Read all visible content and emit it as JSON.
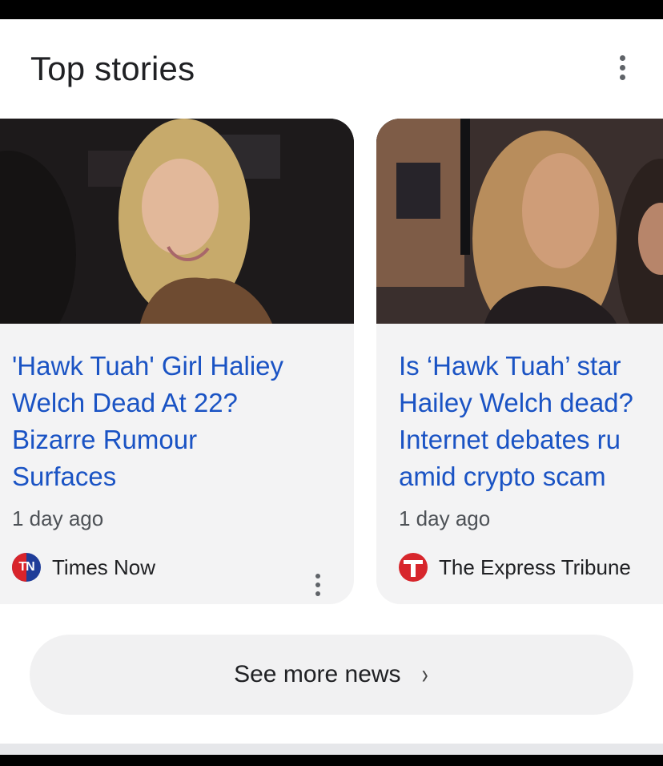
{
  "section": {
    "title": "Top stories"
  },
  "stories": [
    {
      "headline": "'Hawk Tuah' Girl Haliey\nWelch Dead At 22?\nBizarre Rumour\nSurfaces",
      "age": "1 day ago",
      "source": "Times Now",
      "logo_text": "TN"
    },
    {
      "headline": "Is ‘Hawk Tuah’ star\nHailey Welch dead?\nInternet debates ru\namid crypto scam",
      "age": "1 day ago",
      "source": "The Express Tribune"
    }
  ],
  "more": {
    "label": "See more news",
    "chevron": "›"
  },
  "colors": {
    "headline": "#1a53c4",
    "card_bg": "#f3f3f4",
    "times_now_red": "#d8242b",
    "times_now_blue": "#1f3d99",
    "express_tribune_red": "#d7262c"
  },
  "icons": [
    "more-vert-icon",
    "chevron-right-icon",
    "times-now-logo",
    "express-tribune-logo"
  ]
}
